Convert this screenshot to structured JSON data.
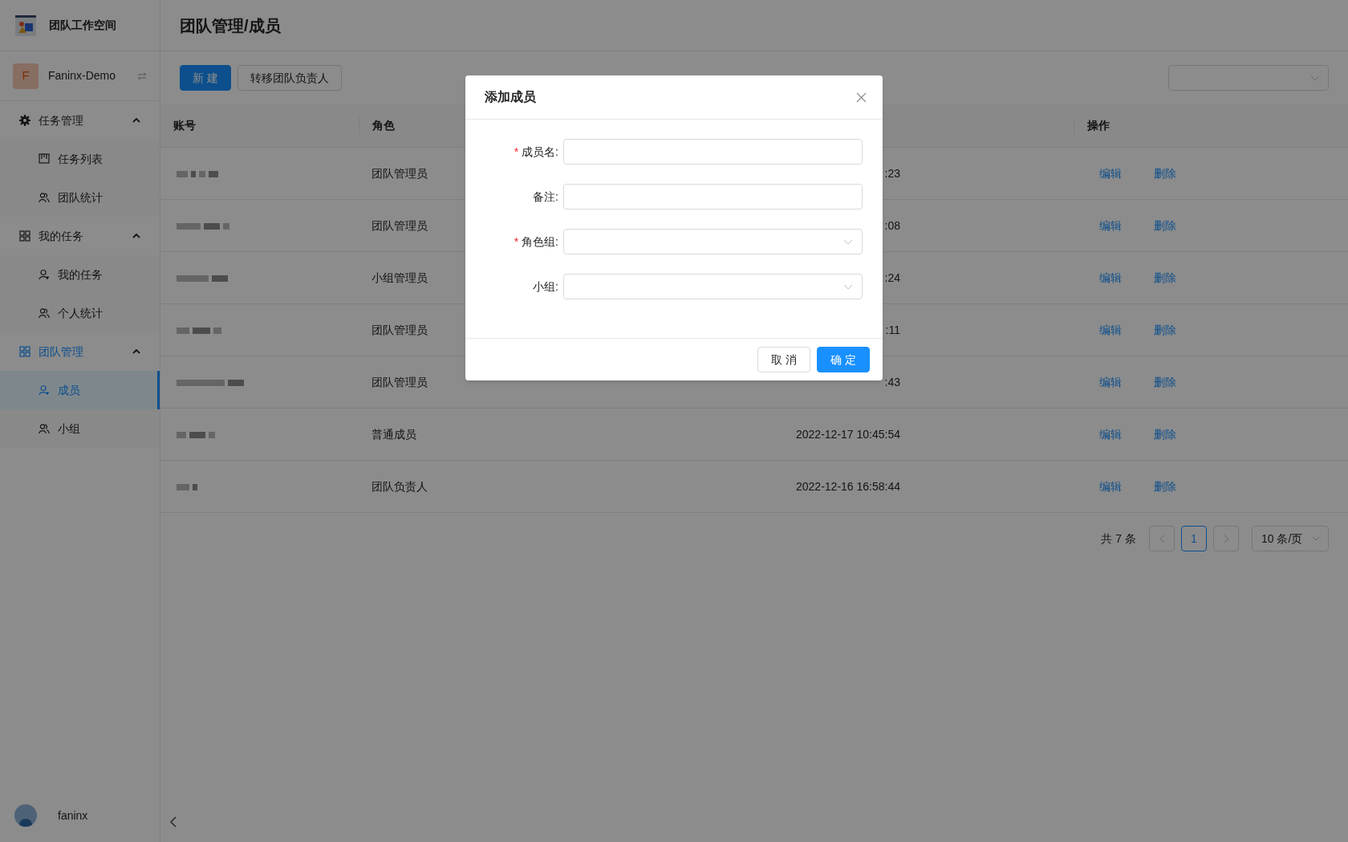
{
  "app": {
    "title": "团队工作空间"
  },
  "team": {
    "initial": "F",
    "name": "Faninx-Demo"
  },
  "menu": [
    {
      "label": "任务管理",
      "expanded": true,
      "active": false,
      "children": [
        {
          "label": "任务列表",
          "selected": false
        },
        {
          "label": "团队统计",
          "selected": false
        }
      ]
    },
    {
      "label": "我的任务",
      "expanded": true,
      "active": false,
      "children": [
        {
          "label": "我的任务",
          "selected": false
        },
        {
          "label": "个人统计",
          "selected": false
        }
      ]
    },
    {
      "label": "团队管理",
      "expanded": true,
      "active": true,
      "children": [
        {
          "label": "成员",
          "selected": true
        },
        {
          "label": "小组",
          "selected": false
        }
      ]
    }
  ],
  "user": {
    "name": "faninx"
  },
  "page": {
    "title": "团队管理/成员"
  },
  "toolbar": {
    "buttons": [
      {
        "label": "新 建",
        "kind": "primary"
      },
      {
        "label": "转移团队负责人",
        "kind": "default"
      }
    ]
  },
  "table": {
    "columns": {
      "account": "账号",
      "role": "角色",
      "actions": "操作"
    },
    "rows": [
      {
        "role": "团队管理员",
        "time": ":23",
        "actions": [
          "编辑",
          "删除"
        ]
      },
      {
        "role": "团队管理员",
        "time": ":08",
        "actions": [
          "编辑",
          "删除"
        ]
      },
      {
        "role": "小组管理员",
        "time": ":24",
        "actions": [
          "编辑",
          "删除"
        ]
      },
      {
        "role": "团队管理员",
        "time": ":11",
        "actions": [
          "编辑",
          "删除"
        ]
      },
      {
        "role": "团队管理员",
        "time": ":43",
        "actions": [
          "编辑",
          "删除"
        ]
      },
      {
        "role": "普通成员",
        "time": "2022-12-17 10:45:54",
        "actions": [
          "编辑",
          "删除"
        ]
      },
      {
        "role": "团队负责人",
        "time": "2022-12-16 16:58:44",
        "actions": [
          "编辑",
          "删除"
        ]
      }
    ]
  },
  "pagination": {
    "total": "共 7 条",
    "pages": [
      {
        "label": "1",
        "selected": true
      }
    ],
    "page_size": "10 条/页"
  },
  "modal": {
    "title": "添加成员",
    "fields": [
      {
        "marker": "*",
        "label": "成员名:",
        "kind": "input"
      },
      {
        "label": "备注:",
        "kind": "input"
      },
      {
        "marker": "*",
        "label": "角色组:",
        "kind": "select"
      },
      {
        "label": "小组:",
        "kind": "select"
      }
    ],
    "buttons": [
      {
        "label": "取 消",
        "kind": "default"
      },
      {
        "label": "确 定",
        "kind": "primary"
      }
    ]
  }
}
